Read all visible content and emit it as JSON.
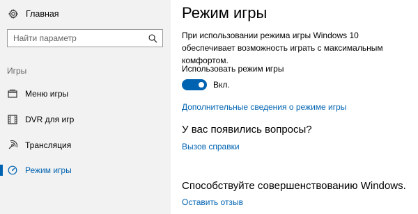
{
  "sidebar": {
    "home_label": "Главная",
    "search_placeholder": "Найти параметр",
    "section_label": "Игры",
    "items": [
      {
        "label": "Меню игры",
        "icon": "game-bar-icon",
        "active": false
      },
      {
        "label": "DVR для игр",
        "icon": "game-dvr-icon",
        "active": false
      },
      {
        "label": "Трансляция",
        "icon": "broadcast-icon",
        "active": false
      },
      {
        "label": "Режим игры",
        "icon": "game-mode-icon",
        "active": true
      }
    ]
  },
  "main": {
    "title": "Режим игры",
    "description": "При использовании режима игры Windows 10 обеспечивает возможность играть с максимальным комфортом.",
    "setting_label": "Использовать режим игры",
    "toggle_on": true,
    "toggle_state": "Вкл.",
    "more_info_link": "Дополнительные сведения о режиме игры",
    "questions_heading": "У вас появились вопросы?",
    "help_link": "Вызов справки",
    "improve_heading": "Способствуйте совершенствованию Windows.",
    "feedback_link": "Оставить отзыв"
  },
  "colors": {
    "accent": "#0063b1",
    "sidebar_bg": "#f2f2f2"
  }
}
